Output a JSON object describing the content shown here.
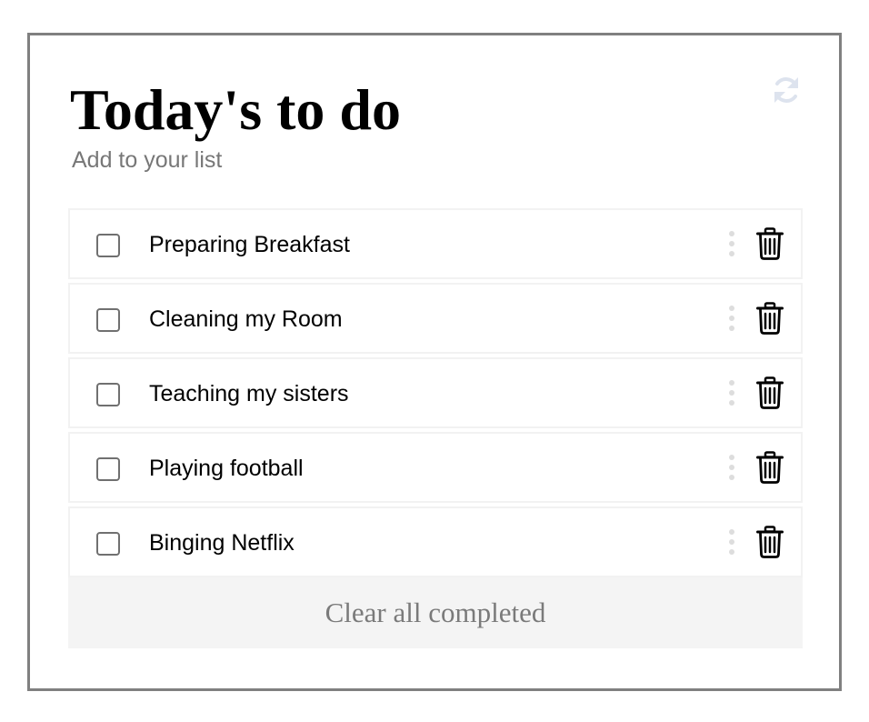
{
  "header": {
    "title": "Today's to do",
    "subtitle": "Add to your list"
  },
  "icons": {
    "refresh": "refresh-icon",
    "drag": "drag-handle-icon",
    "delete": "trash-icon"
  },
  "colors": {
    "border": "#808080",
    "muted_text": "#777777",
    "refresh_icon": "#dde3ee",
    "drag_icon": "#dddddd",
    "footer_bg": "#f4f4f4"
  },
  "todos": [
    {
      "label": "Preparing Breakfast",
      "completed": false
    },
    {
      "label": "Cleaning my Room",
      "completed": false
    },
    {
      "label": "Teaching my sisters",
      "completed": false
    },
    {
      "label": "Playing football",
      "completed": false
    },
    {
      "label": "Binging Netflix",
      "completed": false
    }
  ],
  "footer": {
    "clear_label": "Clear all completed"
  }
}
